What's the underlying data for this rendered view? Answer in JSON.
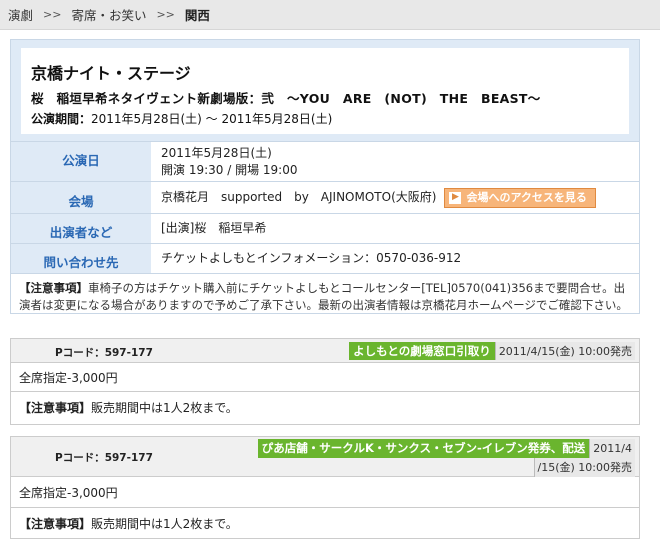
{
  "breadcrumb": {
    "items": [
      "演劇",
      "寄席・お笑い"
    ],
    "separator": ">>",
    "current": "関西"
  },
  "event": {
    "title": "京橋ナイト・ステージ",
    "subtitle": "桜　稲垣早希ネタイヴェント新劇場版：弐　～YOU　ARE　(NOT)　THE　BEAST～",
    "period_label": "公演期間：",
    "period_value": "2011年5月28日(土) ～ 2011年5月28日(土)"
  },
  "info": {
    "date_label": "公演日",
    "date_value": "2011年5月28日(土)",
    "time_value": "開演 19:30 / 開場 19:00",
    "venue_label": "会場",
    "venue_value": "京橋花月　supported　by　AJINOMOTO(大阪府)",
    "access_button": "会場へのアクセスを見る",
    "cast_label": "出演者など",
    "cast_value": "[出演]桜　稲垣早希",
    "contact_label": "問い合わせ先",
    "contact_value": "チケットよしもとインフォメーション：0570-036-912"
  },
  "notice": {
    "tag": "【注意事項】",
    "text": "車椅子の方はチケット購入前にチケットよしもとコールセンター[TEL]0570(041)356まで要問合せ。出演者は変更になる場合がありますので予めご了承下さい。最新の出演者情報は京橋花月ホームページでご確認下さい。"
  },
  "tickets": [
    {
      "pcode": "Pコード：597-177",
      "sale_label": "よしもとの劇場窓口引取り",
      "sale_date": "2011/4/15(金) 10:00発売",
      "price": "全席指定-3,000円",
      "note_tag": "【注意事項】",
      "note_text": "販売期間中は1人2枚まで。"
    },
    {
      "pcode": "Pコード：597-177",
      "sale_label": "ぴあ店舗・サークルK・サンクス・セブン-イレブン発券、配送",
      "sale_date_a": "2011/4",
      "sale_date_b": "/15(金) 10:00発売",
      "price": "全席指定-3,000円",
      "note_tag": "【注意事項】",
      "note_text": "販売期間中は1人2枚まで。"
    }
  ],
  "colors": {
    "label_blue": "#2a68b4",
    "panel_bg": "#dfeaf6",
    "access_orange": "#f7b57a",
    "sale_green": "#6ab52e"
  }
}
